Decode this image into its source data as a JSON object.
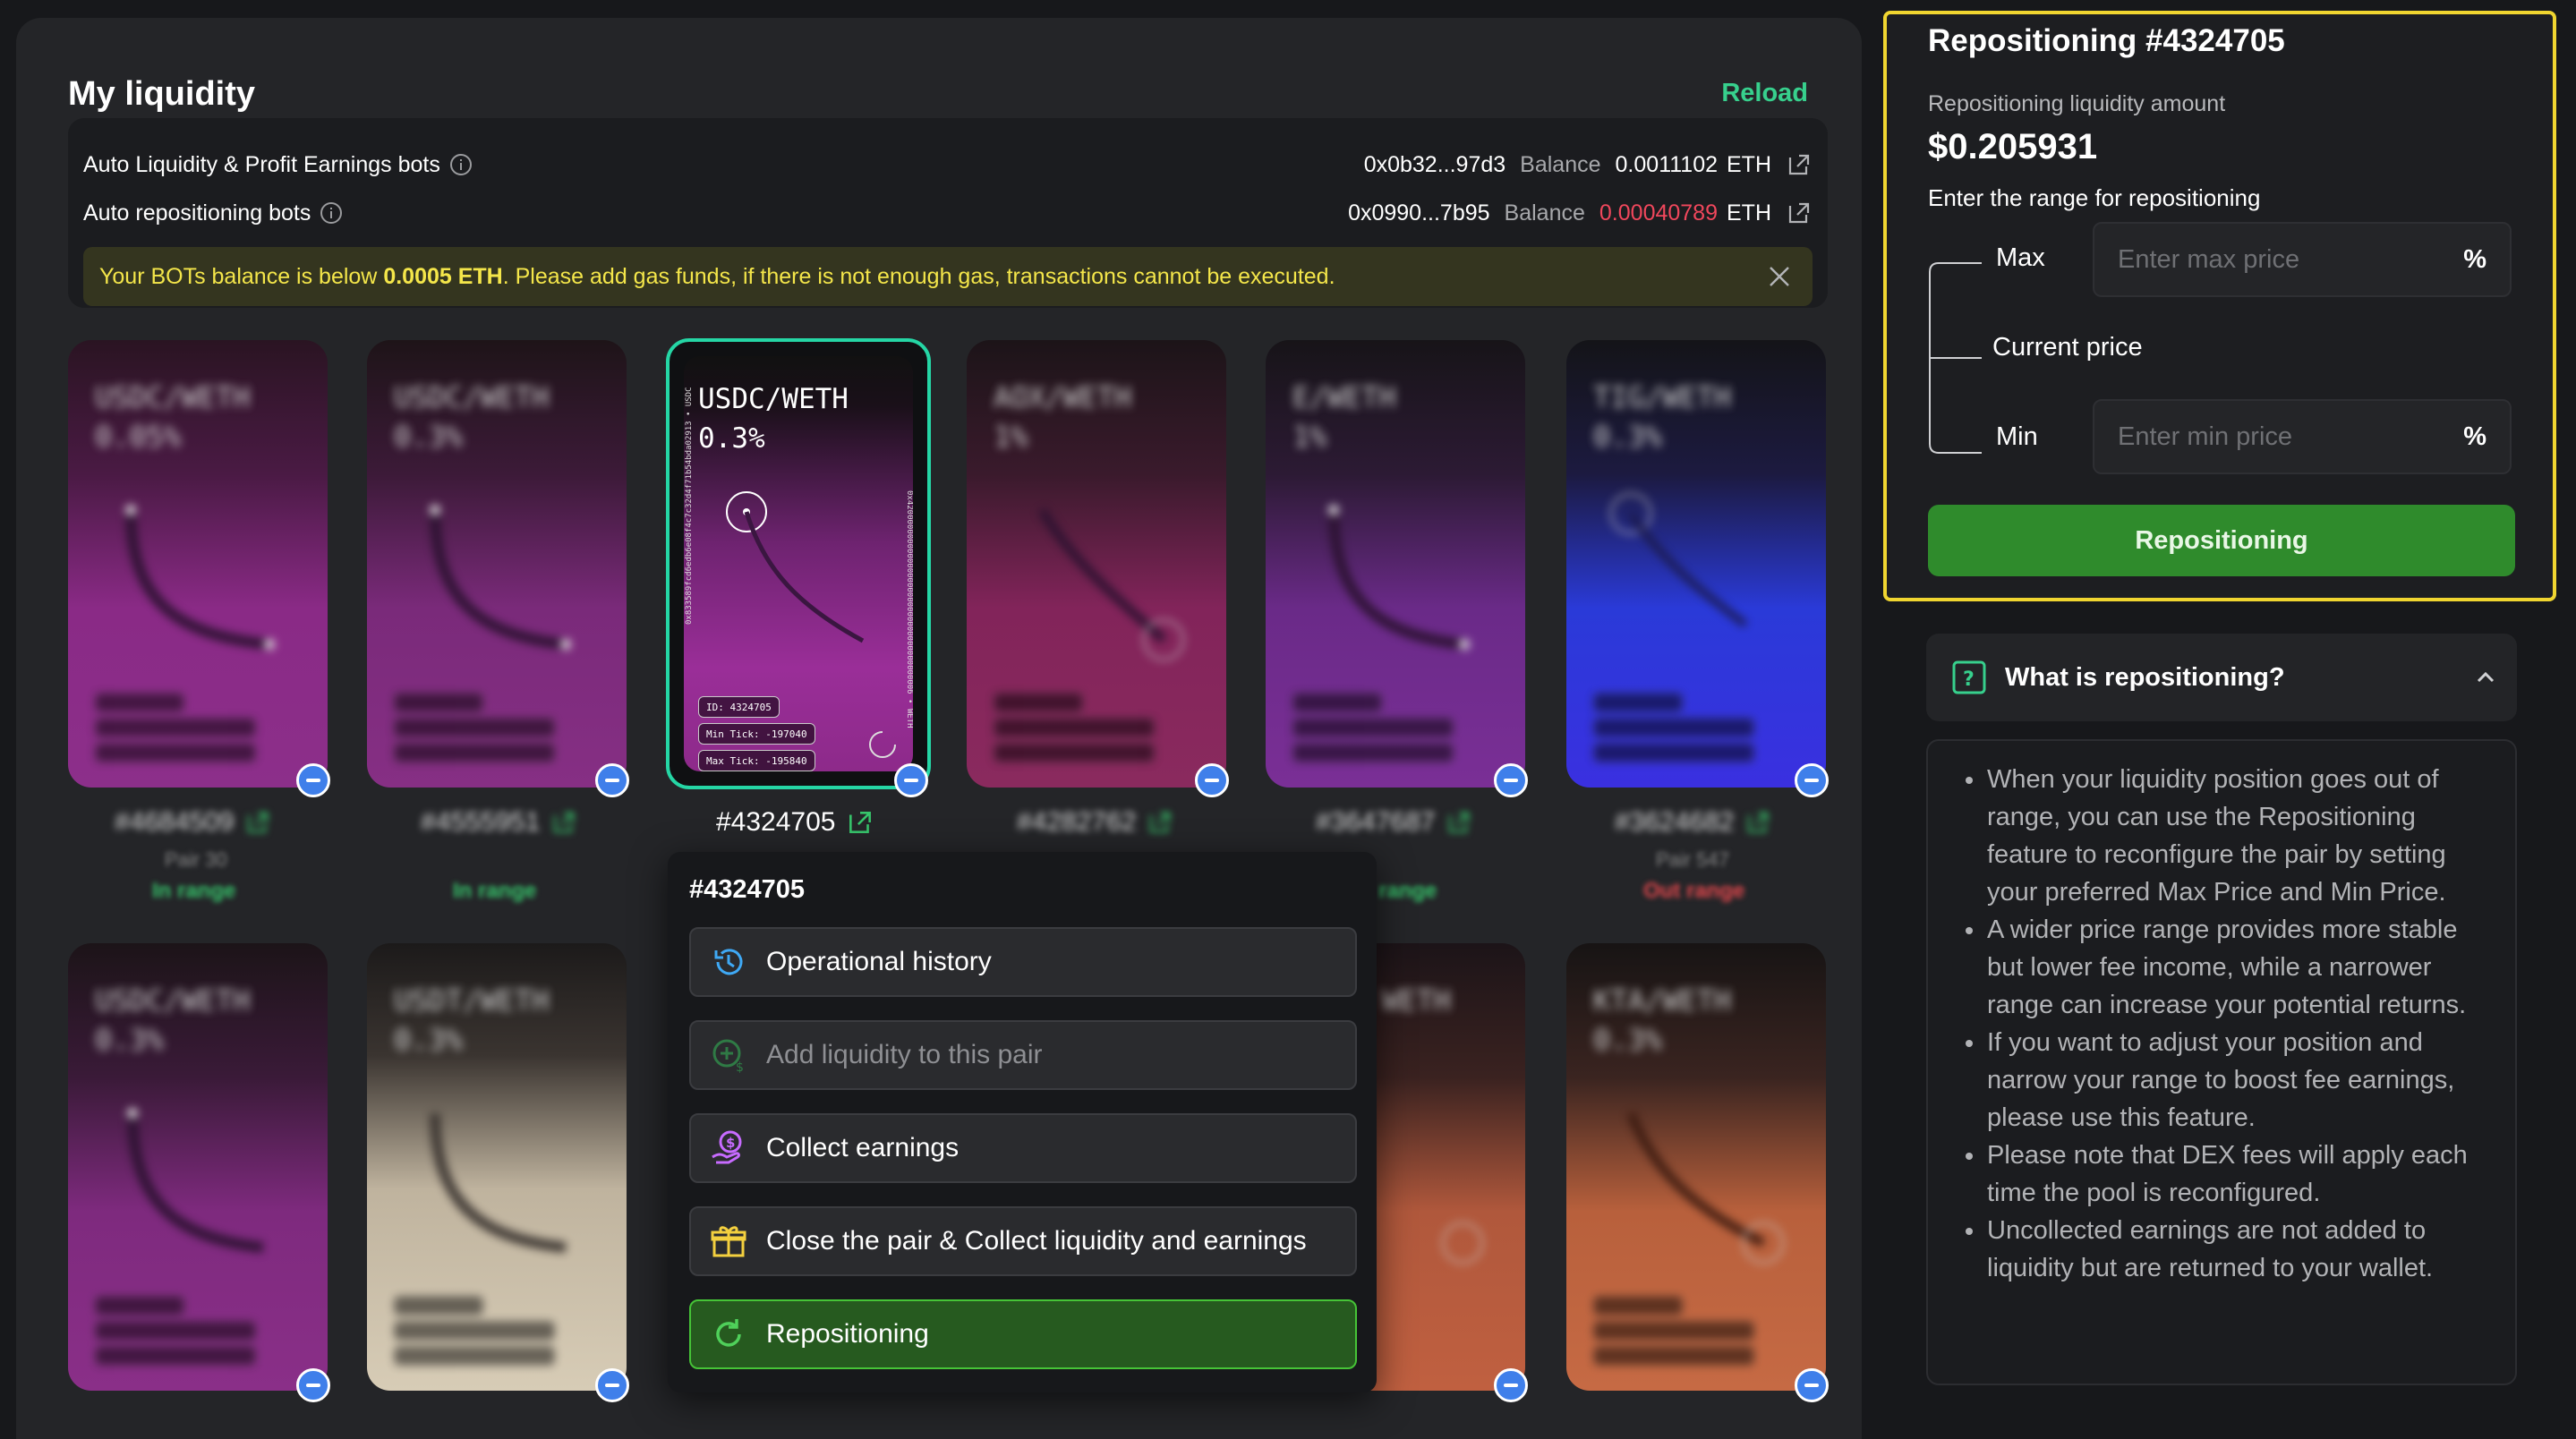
{
  "liquidity": {
    "title": "My liquidity",
    "reload_label": "Reload",
    "bots": [
      {
        "label": "Auto Liquidity & Profit Earnings bots",
        "address": "0x0b32...97d3",
        "balance_label": "Balance",
        "balance": "0.0011102",
        "unit": "ETH"
      },
      {
        "label": "Auto repositioning bots",
        "address": "0x0990...7b95",
        "balance_label": "Balance",
        "balance": "0.00040789",
        "unit": "ETH"
      }
    ],
    "warning": {
      "before": "Your BOTs balance is below ",
      "threshold": "0.0005 ETH",
      "after": ". Please add gas funds, if there is not enough gas, transactions cannot be executed."
    }
  },
  "cards": [
    {
      "pair": "USDC/WETH",
      "fee": "0.05%",
      "id": "#4684509",
      "sub": "Pair 30",
      "status": "In range"
    },
    {
      "pair": "USDC/WETH",
      "fee": "0.3%",
      "id": "#4555951",
      "sub": "",
      "status": "In range"
    },
    {
      "pair": "USDC/WETH",
      "fee": "0.3%",
      "id": "#4324705",
      "tag_id": "ID: 4324705",
      "tag_min": "Min Tick: -197040",
      "tag_max": "Max Tick: -195840"
    },
    {
      "pair": "AOX/WETH",
      "fee": "1%",
      "id": "#4282762",
      "sub": "",
      "status": ""
    },
    {
      "pair": "E/WETH",
      "fee": "1%",
      "id": "#3647687",
      "sub": "",
      "status": "range"
    },
    {
      "pair": "TIG/WETH",
      "fee": "0.3%",
      "id": "#3624682",
      "sub": "Pair 547",
      "status": "Out range"
    },
    {
      "pair": "USDC/WETH",
      "fee": "0.3%"
    },
    {
      "pair": "USDT/WETH",
      "fee": "0.3%"
    },
    {
      "pair": "WETH",
      "fee": ""
    },
    {
      "pair": "KTA/WETH",
      "fee": "0.3%"
    }
  ],
  "menu": {
    "title": "#4324705",
    "items": [
      {
        "label": "Operational history"
      },
      {
        "label": "Add liquidity to this pair"
      },
      {
        "label": "Collect earnings"
      },
      {
        "label": "Close the pair & Collect liquidity and earnings"
      },
      {
        "label": "Repositioning"
      }
    ]
  },
  "repositioning": {
    "title": "Repositioning #4324705",
    "amount_label": "Repositioning liquidity amount",
    "amount": "$0.205931",
    "range_label": "Enter the range for repositioning",
    "max_label": "Max",
    "current_label": "Current price",
    "min_label": "Min",
    "max_placeholder": "Enter max price",
    "min_placeholder": "Enter min price",
    "pct": "%",
    "button_label": "Repositioning"
  },
  "faq": {
    "title": "What is repositioning?",
    "items": [
      "When your liquidity position goes out of range, you can use the Repositioning feature to reconfigure the pair by setting your preferred Max Price and Min Price.",
      "A wider price range provides more stable but lower fee income, while a narrower range can increase your potential returns.",
      "If you want to adjust your position and narrow your range to boost fee earnings, please use this feature.",
      "Please note that DEX fees will apply each time the pool is reconfigured.",
      "Uncollected earnings are not added to liquidity but are returned to your wallet."
    ]
  },
  "colors": {
    "accent_green": "#37d08d",
    "warning_yellow": "#f4e64a",
    "low_balance_red": "#f0475c",
    "panel_border_yellow": "#f0d530",
    "button_green": "#2f8b2c",
    "selected_card_border": "#25d6a5"
  }
}
